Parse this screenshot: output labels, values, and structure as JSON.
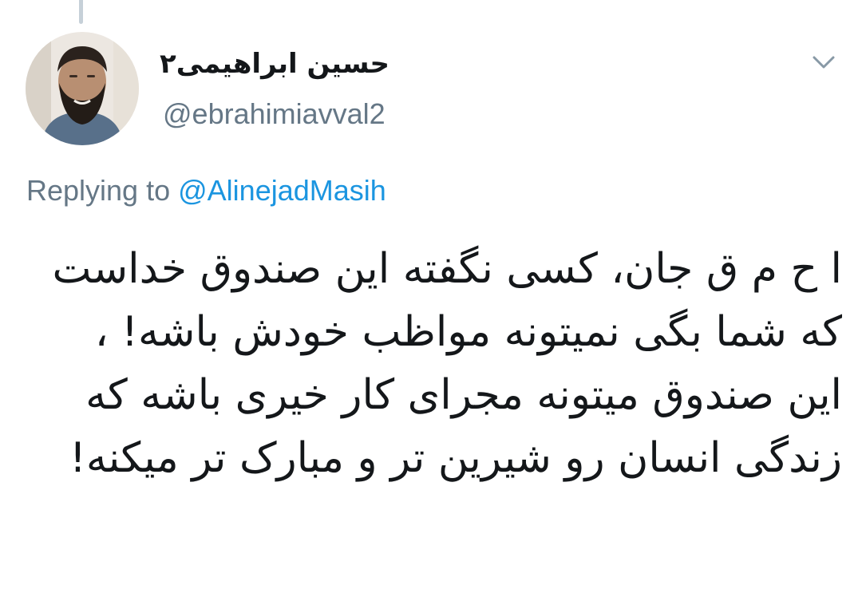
{
  "tweet": {
    "display_name": "حسین ابراهیمی۲",
    "handle": "@ebrahimiavval2",
    "replying_to_label": "Replying to",
    "replying_to_handle": "@AlinejadMasih",
    "text": "ا ح م ق جان، کسی نگفته این صندوق خداست که شما بگی نمیتونه مواظب خودش باشه! ، این صندوق میتونه مجرای کار خیری باشه که زندگی انسان رو شیرین تر و مبارک تر میکنه!"
  },
  "icons": {
    "menu_caret": "chevron-down-icon",
    "avatar": "avatar"
  },
  "colors": {
    "text": "#14171a",
    "secondary": "#657786",
    "link": "#1b95e0",
    "thread_line": "#c6d0d8"
  }
}
